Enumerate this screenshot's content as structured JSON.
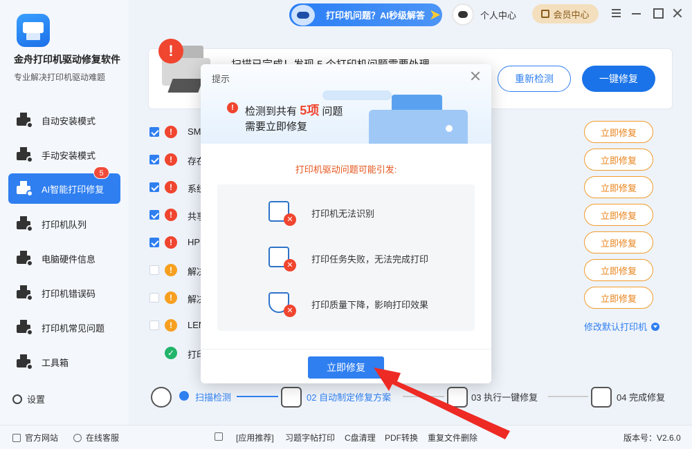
{
  "app": {
    "title": "金舟打印机驱动修复软件",
    "subtitle": "专业解决打印机驱动难题"
  },
  "sidebar": {
    "items": [
      {
        "label": "自动安装模式"
      },
      {
        "label": "手动安装模式"
      },
      {
        "label": "AI智能打印修复",
        "badge": "5",
        "active": true
      },
      {
        "label": "打印机队列"
      },
      {
        "label": "电脑硬件信息"
      },
      {
        "label": "打印机错误码"
      },
      {
        "label": "打印机常见问题"
      },
      {
        "label": "工具箱"
      }
    ],
    "settings_label": "设置"
  },
  "topbar": {
    "ai_label": "打印机问题？AI秒级解答",
    "personal_label": "个人中心",
    "vip_label": "会员中心"
  },
  "scan": {
    "summary_text": "扫描已完成！发现 5 个打印机问题需要处理",
    "rescan_label": "重新检测",
    "fix_all_label": "一键修复"
  },
  "issues": [
    {
      "text": "SM",
      "checked": true,
      "level": "red",
      "button": "立即修复"
    },
    {
      "text": "存在",
      "checked": true,
      "level": "red",
      "button": "立即修复"
    },
    {
      "text": "系统",
      "checked": true,
      "level": "red",
      "button": "立即修复"
    },
    {
      "text": "共享",
      "checked": true,
      "level": "red",
      "button": "立即修复"
    },
    {
      "text": "HP",
      "checked": true,
      "level": "red",
      "button": "立即修复"
    },
    {
      "text": "解决",
      "checked": false,
      "level": "orange",
      "button": "立即修复"
    },
    {
      "text": "解决",
      "checked": false,
      "level": "orange",
      "button": "立即修复"
    },
    {
      "text": "LEN",
      "checked": false,
      "level": "orange",
      "button": ""
    },
    {
      "text": "打印",
      "checked": false,
      "level": "green",
      "button": ""
    }
  ],
  "change_default_label": "修改默认打印机",
  "steps": [
    {
      "label": "扫描检测"
    },
    {
      "label": "02 自动制定修复方案"
    },
    {
      "label": "03 执行一键修复"
    },
    {
      "label": "04 完成修复"
    }
  ],
  "footer": {
    "official_site": "官方网站",
    "online_service": "在线客服",
    "app_recommend": "[应用推荐]",
    "links": [
      "习题字帖打印",
      "C盘清理",
      "PDF转换",
      "重复文件删除"
    ],
    "version": "版本号：V2.6.0"
  },
  "modal": {
    "title": "提示",
    "line1_prefix": "检测到共有",
    "line1_count": "5项",
    "line1_suffix": "问题",
    "line2": "需要立即修复",
    "subtitle": "打印机驱动问题可能引发:",
    "items": [
      {
        "text": "打印机无法识别",
        "icon": "printer-error-icon"
      },
      {
        "text": "打印任务失败，无法完成打印",
        "icon": "document-error-icon"
      },
      {
        "text": "打印质量下降，影响打印效果",
        "icon": "quality-shield-error-icon"
      }
    ],
    "button_label": "立即修复"
  },
  "colors": {
    "primary": "#2f7ff0",
    "danger": "#f0452f",
    "warning": "#f7a020",
    "success": "#22b46a",
    "fix_button": "#e8831b"
  }
}
